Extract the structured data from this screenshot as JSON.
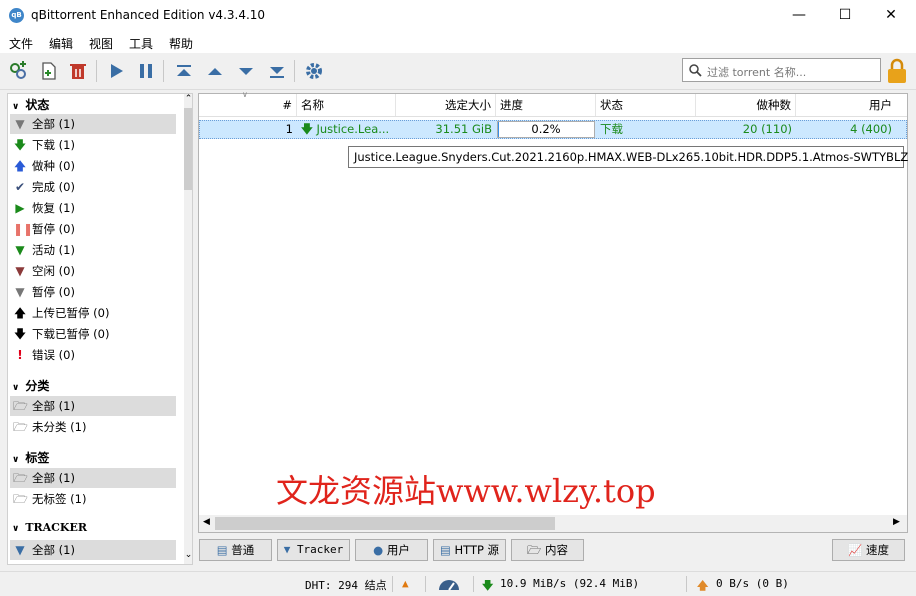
{
  "window": {
    "title": "qBittorrent Enhanced Edition v4.3.4.10",
    "icon_text": "qB"
  },
  "menu": [
    "文件",
    "编辑",
    "视图",
    "工具",
    "帮助"
  ],
  "search": {
    "placeholder": "过滤 torrent 名称..."
  },
  "sidebar": {
    "status_title": "状态",
    "status_items": [
      {
        "label": "全部 (1)"
      },
      {
        "label": "下载 (1)"
      },
      {
        "label": "做种 (0)"
      },
      {
        "label": "完成 (0)"
      },
      {
        "label": "恢复 (1)"
      },
      {
        "label": "暂停 (0)"
      },
      {
        "label": "活动 (1)"
      },
      {
        "label": "空闲 (0)"
      },
      {
        "label": "暂停 (0)"
      },
      {
        "label": "上传已暂停 (0)"
      },
      {
        "label": "下载已暂停 (0)"
      },
      {
        "label": "错误 (0)"
      }
    ],
    "category_title": "分类",
    "category_items": [
      {
        "label": "全部 (1)"
      },
      {
        "label": "未分类 (1)"
      }
    ],
    "tags_title": "标签",
    "tag_items": [
      {
        "label": "全部 (1)"
      },
      {
        "label": "无标签 (1)"
      }
    ],
    "tracker_title": "TRACKER",
    "tracker_items": [
      {
        "label": "全部 (1)"
      }
    ]
  },
  "table": {
    "headers": [
      "#",
      "名称",
      "选定大小",
      "进度",
      "状态",
      "做种数",
      "用户"
    ],
    "rows": [
      {
        "num": "1",
        "name": "Justice.Lea...",
        "size": "31.51 GiB",
        "progress": "0.2%",
        "progress_value": 0.002,
        "status": "下载",
        "seeds": "20 (110)",
        "peers": "4 (400)"
      }
    ]
  },
  "tooltip": "Justice.League.Snyders.Cut.2021.2160p.HMAX.WEB-DLx265.10bit.HDR.DDP5.1.Atmos-SWTYBLZ",
  "watermark": "文龙资源站www.wlzy.top",
  "bottom_tabs": {
    "general": "普通",
    "trackers": "Tracker",
    "peers": "用户",
    "http": "HTTP 源",
    "content": "内容",
    "speed": "速度"
  },
  "statusbar": {
    "dht": "DHT: 294 结点",
    "download": "10.9 MiB/s (92.4 MiB)",
    "upload": "0 B/s (0 B)"
  },
  "colors": {
    "accent": "#1b8a1b",
    "selection": "#cce8ff",
    "watermark": "#e0241c"
  }
}
